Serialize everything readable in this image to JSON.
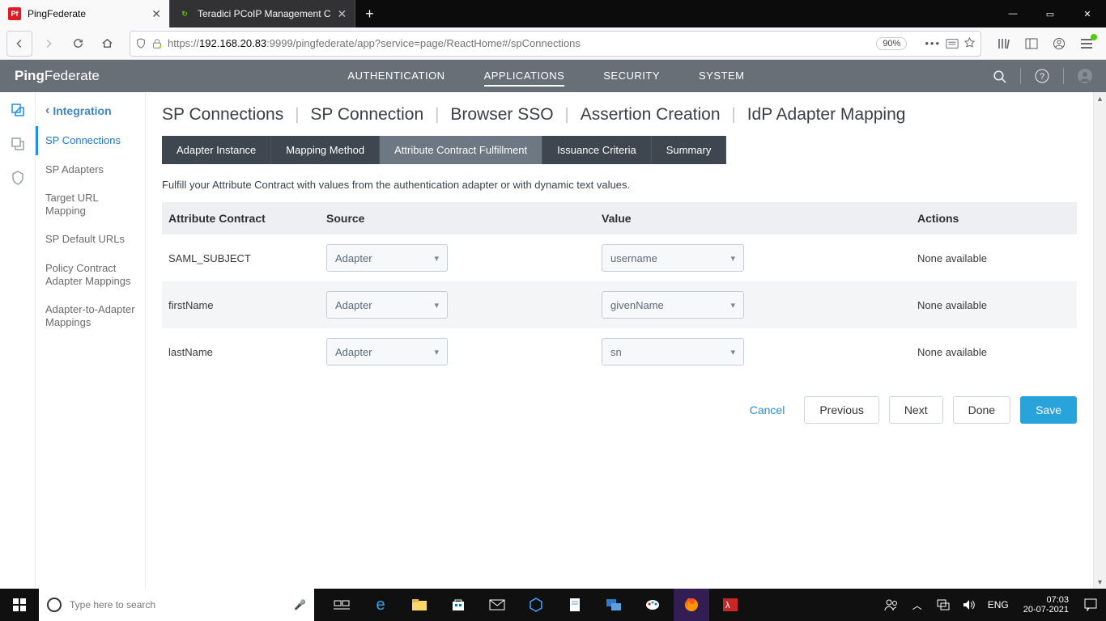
{
  "browser": {
    "tabs": [
      {
        "label": "PingFederate",
        "favicon_text": "Pf",
        "favicon_bg": "#e11b22",
        "favicon_fg": "#ffffff"
      },
      {
        "label": "Teradici PCoIP Management C",
        "favicon_text": "↻",
        "favicon_bg": "transparent",
        "favicon_fg": "#51cd00"
      }
    ],
    "url_prefix": "https://",
    "url_host": "192.168.20.83",
    "url_rest": ":9999/pingfederate/app?service=page/ReactHome#/spConnections",
    "zoom": "90%"
  },
  "app": {
    "brand_left": "Ping",
    "brand_right": "Federate",
    "nav": [
      "AUTHENTICATION",
      "APPLICATIONS",
      "SECURITY",
      "SYSTEM"
    ],
    "nav_active": "APPLICATIONS"
  },
  "sidebar": {
    "heading": "Integration",
    "items": [
      "SP Connections",
      "SP Adapters",
      "Target URL Mapping",
      "SP Default URLs",
      "Policy Contract Adapter Mappings",
      "Adapter-to-Adapter Mappings"
    ],
    "active": "SP Connections"
  },
  "breadcrumbs": [
    "SP Connections",
    "SP Connection",
    "Browser SSO",
    "Assertion Creation",
    "IdP Adapter Mapping"
  ],
  "steps": {
    "items": [
      "Adapter Instance",
      "Mapping Method",
      "Attribute Contract Fulfillment",
      "Issuance Criteria",
      "Summary"
    ],
    "active": "Attribute Contract Fulfillment"
  },
  "description": "Fulfill your Attribute Contract with values from the authentication adapter or with dynamic text values.",
  "table": {
    "headers": {
      "contract": "Attribute Contract",
      "source": "Source",
      "value": "Value",
      "actions": "Actions"
    },
    "rows": [
      {
        "contract": "SAML_SUBJECT",
        "source": "Adapter",
        "value": "username",
        "actions": "None available"
      },
      {
        "contract": "firstName",
        "source": "Adapter",
        "value": "givenName",
        "actions": "None available"
      },
      {
        "contract": "lastName",
        "source": "Adapter",
        "value": "sn",
        "actions": "None available"
      }
    ]
  },
  "buttons": {
    "cancel": "Cancel",
    "previous": "Previous",
    "next": "Next",
    "done": "Done",
    "save": "Save"
  },
  "taskbar": {
    "search_placeholder": "Type here to search",
    "lang": "ENG",
    "time": "07:03",
    "date": "20-07-2021"
  }
}
